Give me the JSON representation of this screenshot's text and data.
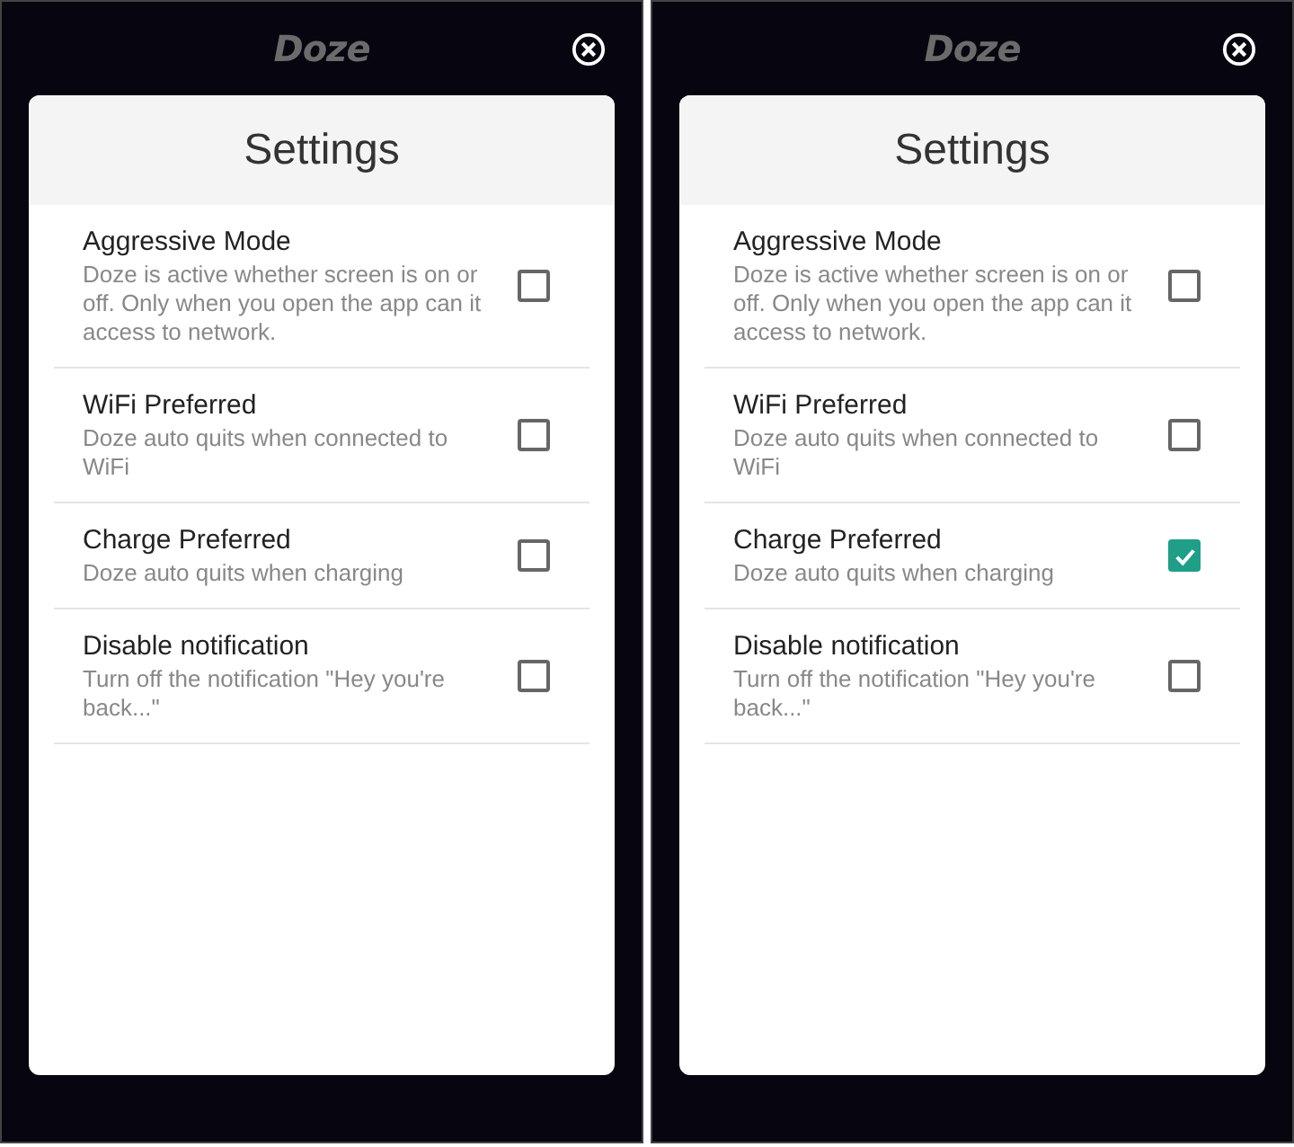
{
  "screens": [
    {
      "app_title": "Doze",
      "panel_title": "Settings",
      "settings": [
        {
          "title": "Aggressive Mode",
          "description": "Doze is active whether screen is on or off. Only when you open the app can it access to network.",
          "checked": false
        },
        {
          "title": "WiFi Preferred",
          "description": "Doze auto quits when connected to WiFi",
          "checked": false
        },
        {
          "title": "Charge Preferred",
          "description": "Doze auto quits when charging",
          "checked": false
        },
        {
          "title": "Disable notification",
          "description": "Turn off the notification \"Hey you're back...\"",
          "checked": false
        }
      ]
    },
    {
      "app_title": "Doze",
      "panel_title": "Settings",
      "settings": [
        {
          "title": "Aggressive Mode",
          "description": "Doze is active whether screen is on or off. Only when you open the app can it access to network.",
          "checked": false
        },
        {
          "title": "WiFi Preferred",
          "description": "Doze auto quits when connected to WiFi",
          "checked": false
        },
        {
          "title": "Charge Preferred",
          "description": "Doze auto quits when charging",
          "checked": true
        },
        {
          "title": "Disable notification",
          "description": "Turn off the notification \"Hey you're back...\"",
          "checked": false
        }
      ]
    }
  ]
}
